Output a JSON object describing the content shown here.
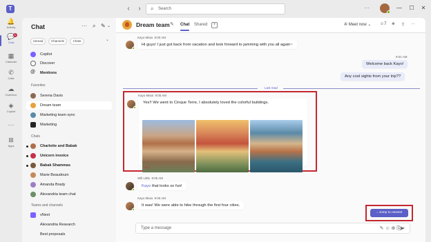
{
  "titlebar": {
    "search_placeholder": "Search",
    "back_glyph": "‹",
    "forward_glyph": "›",
    "more_glyph": "···",
    "minimize_glyph": "—",
    "maximize_glyph": "☐",
    "close_glyph": "✕",
    "search_glyph": "⌕",
    "logo_glyph": "T"
  },
  "rail": {
    "items": [
      {
        "label": "Activity",
        "glyph": "🔔"
      },
      {
        "label": "Chat",
        "glyph": "💬",
        "badge": "1"
      },
      {
        "label": "Calendar",
        "glyph": "▦"
      },
      {
        "label": "Calls",
        "glyph": "✆"
      },
      {
        "label": "OneDrive",
        "glyph": "☁"
      },
      {
        "label": "Copilot",
        "glyph": "◈"
      },
      {
        "label": "",
        "glyph": "···"
      },
      {
        "label": "Apps",
        "glyph": "⊞"
      }
    ]
  },
  "panel": {
    "title": "Chat",
    "filters": [
      "Unread",
      "Channels",
      "Chats"
    ],
    "caret_glyph": "⌄",
    "more_glyph": "···",
    "search_glyph": "⌕",
    "compose_glyph": "✎",
    "pinned": [
      {
        "label": "Copilot",
        "bold": false,
        "color": "#7b61ff"
      },
      {
        "label": "Discover",
        "bold": false,
        "color": "#616161"
      },
      {
        "label": "Mentions",
        "bold": true,
        "color": "#242424"
      }
    ],
    "favorites_label": "Favorites",
    "favorites": [
      {
        "label": "Serena Davis",
        "bold": false,
        "color": "#8a6a52"
      },
      {
        "label": "Dream team",
        "bold": false,
        "color": "#e8a33d"
      },
      {
        "label": "Marketing team sync",
        "bold": false,
        "color": "#5b8aa8"
      },
      {
        "label": "Marketing",
        "bold": false,
        "color": "#242424"
      }
    ],
    "chats_label": "Chats",
    "chats": [
      {
        "label": "Charlotte and Babak",
        "bold": true,
        "color": "#b07049"
      },
      {
        "label": "Unicorn invoice",
        "bold": true,
        "color": "#c4314b"
      },
      {
        "label": "Babak Shammas",
        "bold": true,
        "color": "#7a5a3a"
      },
      {
        "label": "Marie Beaudouin",
        "bold": false,
        "color": "#c58a5c"
      },
      {
        "label": "Amanda Brady",
        "bold": false,
        "color": "#9b7fc4"
      },
      {
        "label": "Alexandria team chat",
        "bold": false,
        "color": "#6b8f6a"
      }
    ],
    "teams_label": "Teams and channels",
    "teams": [
      {
        "label": "vNext",
        "bold": false,
        "color": "#7b61ff"
      },
      {
        "label": "Alexandria Research",
        "bold": false,
        "color": "transparent"
      },
      {
        "label": "Best proposals",
        "bold": false,
        "color": "transparent"
      }
    ]
  },
  "chat": {
    "title": "Dream team",
    "edit_glyph": "✎",
    "tabs": [
      "Chat",
      "Shared"
    ],
    "tab_add_glyph": "+",
    "meet_now": "Meet now",
    "meet_caret": "⌄",
    "participants_count": "7",
    "header_icon_glyphs": [
      "⎈",
      "⇪",
      "···"
    ],
    "messages": {
      "m1_sender": "Kayo Miwa",
      "m1_time": "9:00 AM",
      "m1_text": "Hi guys! I just got back from vacation and look forward to jamming with you all again~",
      "mine_time": "9:01 AM",
      "mine_1": "Welcome back Kayo!",
      "mine_2": "Any cool sights from your trip??",
      "last_read": "Last read",
      "m2_sender": "Kayo Miwa",
      "m2_time": "9:05 AM",
      "m2_text": "Yes!! We went to Cinque Terre, I absolutely loved the colorful buildings.",
      "m2_reaction": "♥ 1",
      "m3_sender": "Will Little",
      "m3_time": "9:05 AM",
      "m3_mention": "Kayo",
      "m3_text": " that looks so fun!",
      "m4_sender": "Kayo Miwa",
      "m4_time": "9:06 AM",
      "m4_text": "It was! We were able to hike through the first four cities."
    },
    "jump_label": "↓  Jump to newest",
    "compose_placeholder": "Type a message",
    "compose_icons": "✎  ☺  ⊕  ⎘  +",
    "send_glyph": "➤"
  },
  "colors": {
    "accent": "#5b5fc7",
    "highlight": "#c4262e",
    "mine_bubble": "#e8ebfa",
    "presence": "#6bb700"
  }
}
